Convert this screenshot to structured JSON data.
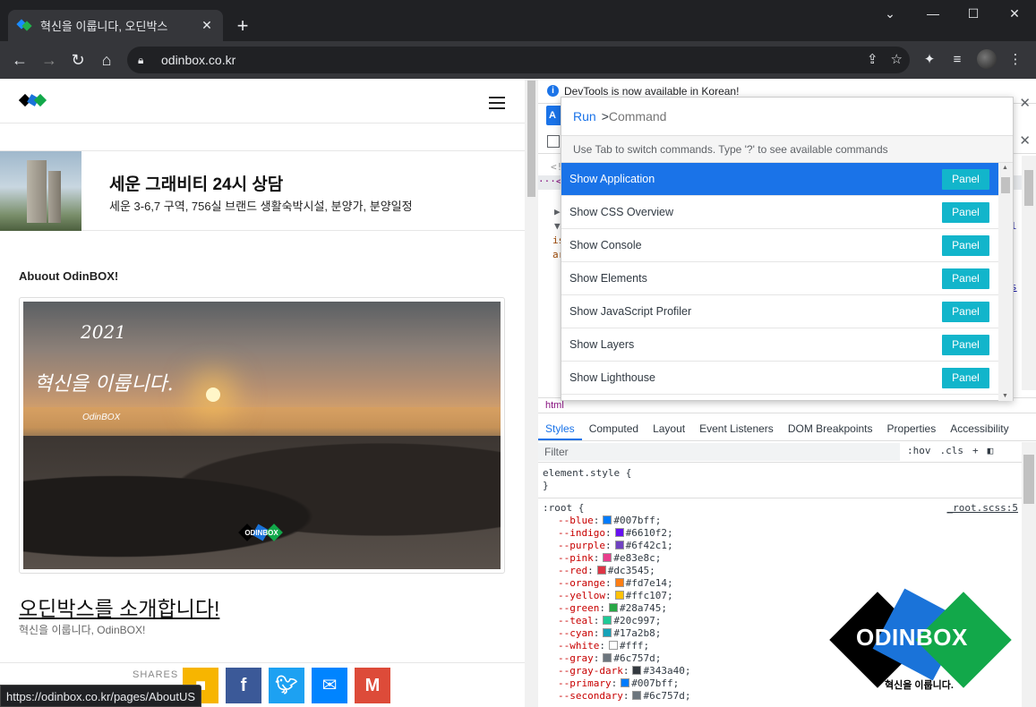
{
  "browser": {
    "tab_title": "혁신을 이룹니다, 오딘박스",
    "url": "odinbox.co.kr",
    "window_controls": [
      "minimize",
      "maximize",
      "close"
    ]
  },
  "page": {
    "banner_title": "세운 그래비티 24시 상담",
    "banner_subtitle": "세운 3-6,7 구역, 756실 브랜드 생활숙박시설, 분양가, 분양일정",
    "about_label": "Abuout OdinBOX!",
    "photo_year": "2021",
    "photo_slogan": "혁신을 이룹니다.",
    "photo_brand": "OdinBOX",
    "photo_logo_text": "ODINBOX",
    "intro_title": "오딘박스를 소개합니다!",
    "intro_subtitle": "혁신을 이룹니다, OdinBOX!",
    "share_label": "SHARES",
    "status_url": "https://odinbox.co.kr/pages/AboutUS",
    "share_buttons": [
      {
        "name": "facebook",
        "glyph": "f",
        "color": "#3b5998"
      },
      {
        "name": "twitter",
        "glyph": "t",
        "color": "#1da1f2"
      },
      {
        "name": "messenger",
        "glyph": "m",
        "color": "#0084ff"
      },
      {
        "name": "gmail",
        "glyph": "M",
        "color": "#dd4b39"
      }
    ]
  },
  "devtools": {
    "infobar": "DevTools is now available in Korean!",
    "breadcrumb": "html",
    "subtabs": [
      "Styles",
      "Computed",
      "Layout",
      "Event Listeners",
      "DOM Breakpoints",
      "Properties",
      "Accessibility"
    ],
    "filter_placeholder": "Filter",
    "hov": ":hov",
    "cls": ".cls",
    "element_style": "element.style {",
    "element_close": "}",
    "root_selector": ":root {",
    "root_source": "_root.scss:5",
    "variables": [
      {
        "name": "--blue",
        "value": "#007bff"
      },
      {
        "name": "--indigo",
        "value": "#6610f2"
      },
      {
        "name": "--purple",
        "value": "#6f42c1"
      },
      {
        "name": "--pink",
        "value": "#e83e8c"
      },
      {
        "name": "--red",
        "value": "#dc3545"
      },
      {
        "name": "--orange",
        "value": "#fd7e14"
      },
      {
        "name": "--yellow",
        "value": "#ffc107"
      },
      {
        "name": "--green",
        "value": "#28a745"
      },
      {
        "name": "--teal",
        "value": "#20c997"
      },
      {
        "name": "--cyan",
        "value": "#17a2b8"
      },
      {
        "name": "--white",
        "value": "#fff"
      },
      {
        "name": "--gray",
        "value": "#6c757d"
      },
      {
        "name": "--gray-dark",
        "value": "#343a40"
      },
      {
        "name": "--primary",
        "value": "#007bff"
      },
      {
        "name": "--secondary",
        "value": "#6c757d"
      }
    ],
    "command_menu": {
      "run_label": "Run",
      "prefix": ">",
      "placeholder": "Command",
      "hint": "Use Tab to switch commands. Type '?' to see available commands",
      "items": [
        {
          "label": "Show Application",
          "badge": "Panel"
        },
        {
          "label": "Show CSS Overview",
          "badge": "Panel"
        },
        {
          "label": "Show Console",
          "badge": "Panel"
        },
        {
          "label": "Show Elements",
          "badge": "Panel"
        },
        {
          "label": "Show JavaScript Profiler",
          "badge": "Panel"
        },
        {
          "label": "Show Layers",
          "badge": "Panel"
        },
        {
          "label": "Show Lighthouse",
          "badge": "Panel"
        }
      ]
    }
  },
  "watermark": {
    "word": "ODINBOX",
    "tagline": "혁신을 이룹니다."
  }
}
